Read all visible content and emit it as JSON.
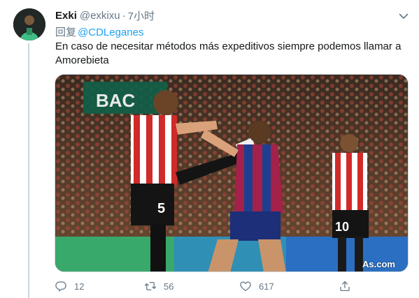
{
  "tweet": {
    "display_name": "Exki",
    "handle": "@exkixu",
    "separator": "·",
    "time": "7小时",
    "reply_prefix": "回复",
    "reply_to": "@CDLeganes",
    "text": "En caso de necesitar métodos más expeditivos siempre podemos llamar a Amorebieta",
    "media_watermark": "As.com",
    "stadium_board": "BAC",
    "player_left_number": "5",
    "player_right_number": "10"
  },
  "actions": {
    "reply_count": "12",
    "retweet_count": "56",
    "like_count": "617"
  },
  "icons": {
    "avatar": "avatar-image",
    "caret": "chevron-down-icon",
    "reply": "reply-icon",
    "retweet": "retweet-icon",
    "like": "heart-icon",
    "share": "share-icon"
  },
  "colors": {
    "text_primary": "#14171a",
    "text_secondary": "#657786",
    "link": "#1da1f2",
    "border": "#ccd6dd"
  }
}
